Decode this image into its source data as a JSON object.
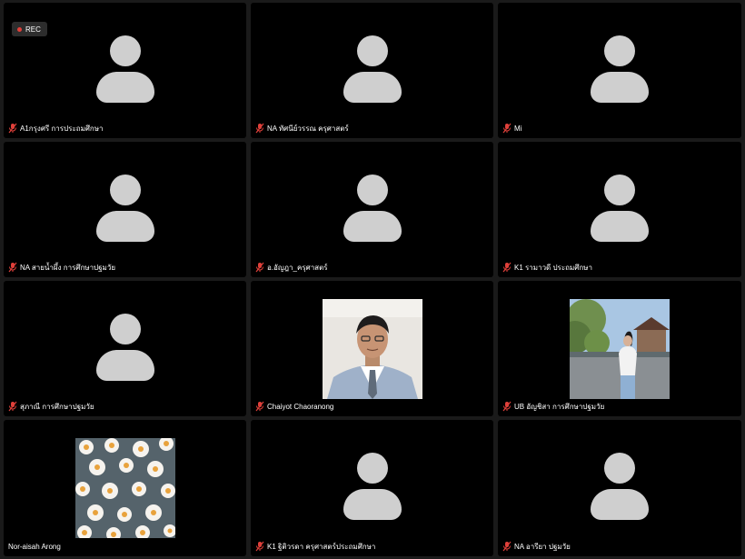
{
  "recording": {
    "label": "REC",
    "indicator_color": "#e0403a"
  },
  "participants": [
    {
      "name": "A1กรุงศรี การประถมศึกษา",
      "muted": true,
      "video": "avatar"
    },
    {
      "name": "NA ทัศนีย์วรรณ ครุศาสตร์",
      "muted": true,
      "video": "avatar"
    },
    {
      "name": "Mi",
      "muted": true,
      "video": "avatar"
    },
    {
      "name": "NA สายน้ำผึ้ง การศึกษาปฐมวัย",
      "muted": true,
      "video": "avatar"
    },
    {
      "name": "อ.อัญฎา_ครุศาสตร์",
      "muted": true,
      "video": "avatar"
    },
    {
      "name": "K1 รามาวดี ประถมศึกษา",
      "muted": true,
      "video": "avatar"
    },
    {
      "name": "สุภาณี การศึกษาปฐมวัย",
      "muted": true,
      "video": "avatar"
    },
    {
      "name": "Chaiyot Chaoranong",
      "muted": true,
      "video": "photo"
    },
    {
      "name": "UB อัญชิสา การศึกษาปฐมวัย",
      "muted": true,
      "video": "photo"
    },
    {
      "name": "Nor-aisah Arong",
      "muted": true,
      "video": "photo"
    },
    {
      "name": "K1 ฐิติวรดา ครุศาสตร์ประถมศึกษา",
      "muted": true,
      "video": "avatar"
    },
    {
      "name": "NA อารียา ปฐมวัย",
      "muted": true,
      "video": "avatar"
    }
  ],
  "colors": {
    "tile_bg": "#000000",
    "avatar": "#cfcfcf",
    "muted_icon": "#e0403a"
  }
}
